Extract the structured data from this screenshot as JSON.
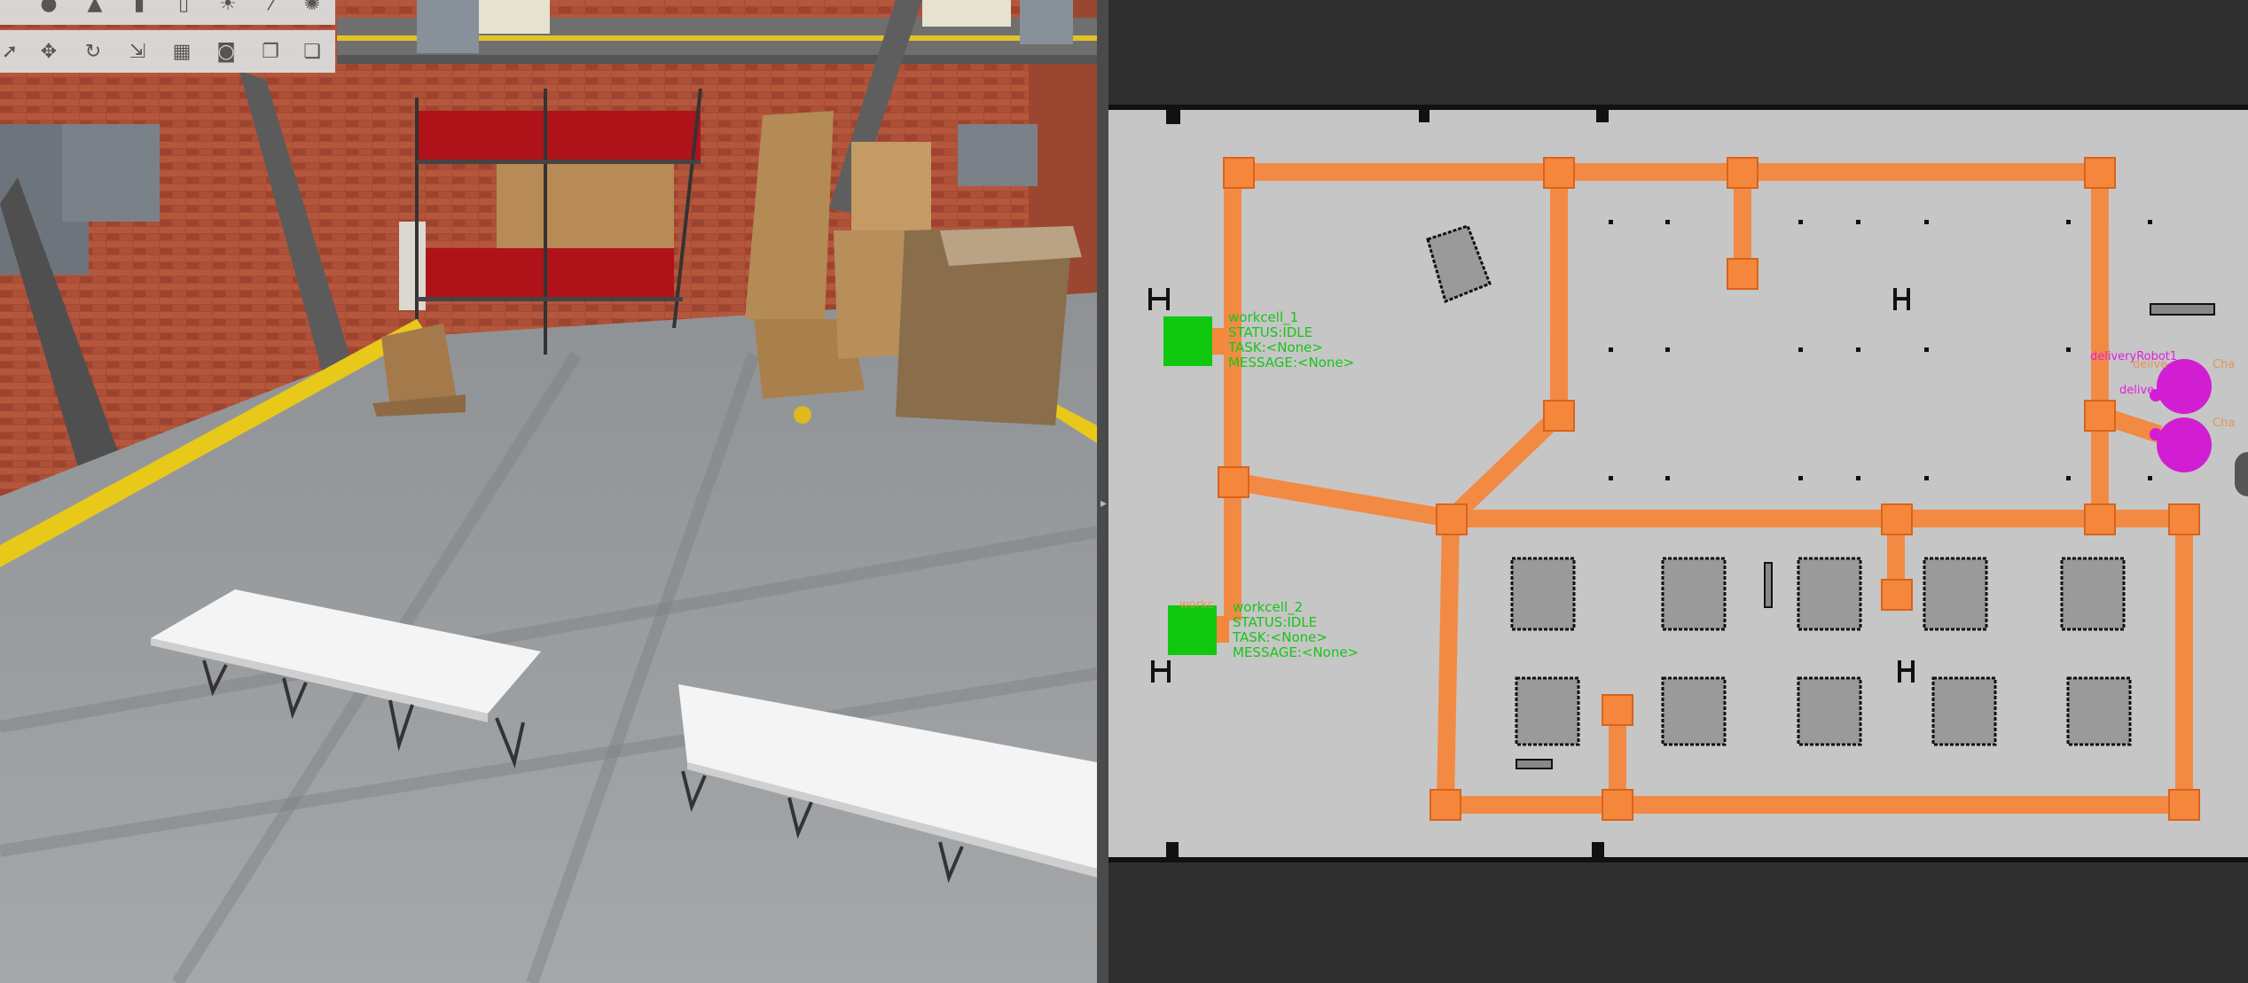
{
  "toolbar": {
    "row1": [
      "sphere-icon",
      "cone-icon",
      "cylinder-icon",
      "capsule-icon",
      "sun-light-icon",
      "directional-light-icon",
      "spot-light-icon"
    ],
    "row2": [
      "select-arrow-icon",
      "translate-icon",
      "rotate-icon",
      "scale-icon",
      "snap-grid-icon",
      "screenshot-camera-icon",
      "copy-icon",
      "paste-icon"
    ]
  },
  "workcells": [
    {
      "name": "workcell_1",
      "status": "STATUS:IDLE",
      "task": "TASK:<None>",
      "message": "MESSAGE:<None>"
    },
    {
      "name": "workcell_2",
      "status": "STATUS:IDLE",
      "task": "TASK:<None>",
      "message": "MESSAGE:<None>",
      "ghost": "workc"
    }
  ],
  "robots": [
    {
      "name": "deliveryRobot1",
      "ghost": "delive",
      "ghost_right": "Cha"
    },
    {
      "name": "delive",
      "ghost_right": "Cha"
    }
  ],
  "colors": {
    "lane": "#f5873c",
    "workcell": "#0fc80f",
    "robot": "#d21ed2",
    "map_floor": "#c6c6c6",
    "map_wall": "#111111"
  }
}
